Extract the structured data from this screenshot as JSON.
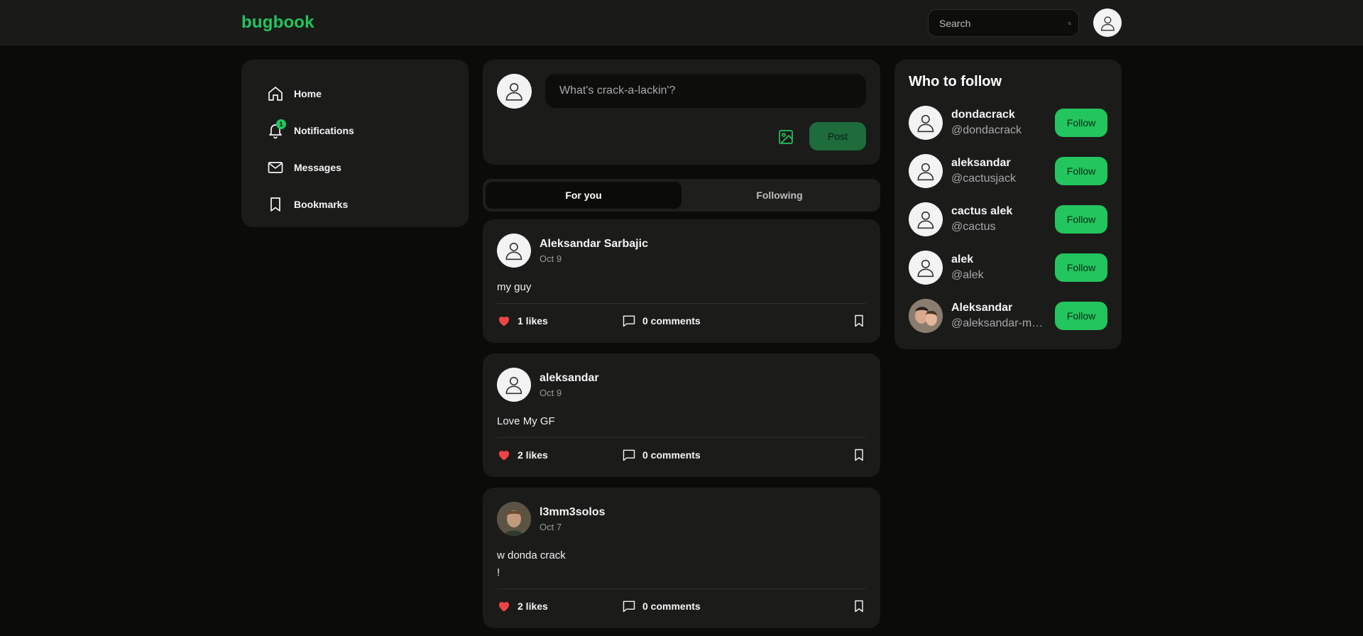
{
  "app": {
    "logo": "bugbook"
  },
  "search": {
    "placeholder": "Search"
  },
  "sidebar": {
    "items": [
      {
        "label": "Home",
        "icon": "home-icon"
      },
      {
        "label": "Notifications",
        "icon": "bell-icon",
        "badge": "1"
      },
      {
        "label": "Messages",
        "icon": "mail-icon"
      },
      {
        "label": "Bookmarks",
        "icon": "bookmark-icon"
      }
    ]
  },
  "composer": {
    "placeholder": "What's crack-a-lackin'?",
    "post_label": "Post"
  },
  "tabs": [
    {
      "label": "For you",
      "active": true
    },
    {
      "label": "Following",
      "active": false
    }
  ],
  "posts": [
    {
      "author": "Aleksandar Sarbajic",
      "date": "Oct 9",
      "body": "my guy",
      "likes": "1 likes",
      "comments": "0 comments"
    },
    {
      "author": "aleksandar",
      "date": "Oct 9",
      "body": "Love My GF",
      "likes": "2 likes",
      "comments": "0 comments"
    },
    {
      "author": "l3mm3solos",
      "date": "Oct 7",
      "body": "w donda crack\n!",
      "likes": "2 likes",
      "comments": "0 comments"
    }
  ],
  "who_to_follow": {
    "title": "Who to follow",
    "follow_label": "Follow",
    "users": [
      {
        "name": "dondacrack",
        "handle": "@dondacrack"
      },
      {
        "name": "aleksandar",
        "handle": "@cactusjack"
      },
      {
        "name": "cactus alek",
        "handle": "@cactus"
      },
      {
        "name": "alek",
        "handle": "@alek"
      },
      {
        "name": "Aleksandar",
        "handle": "@aleksandar-mx..."
      }
    ]
  },
  "colors": {
    "accent": "#22c55e",
    "like": "#ef4444",
    "background": "#0b0b0a",
    "card": "#1b1b1a"
  }
}
